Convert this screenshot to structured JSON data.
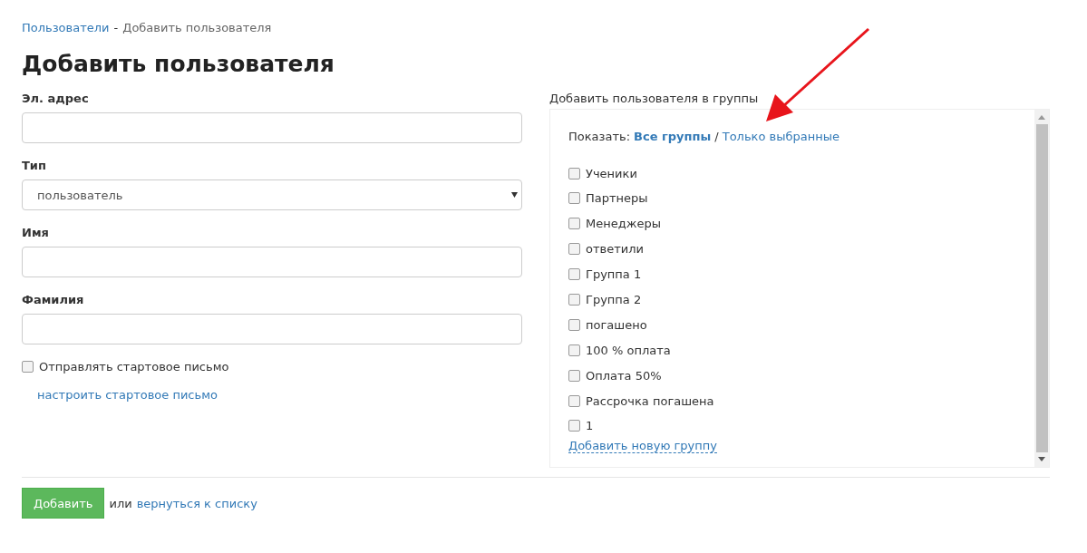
{
  "breadcrumb": {
    "parent": "Пользователи",
    "separator": "-",
    "current": "Добавить пользователя"
  },
  "title": "Добавить пользователя",
  "fields": [
    {
      "kind": "text",
      "label": "Эл. адрес"
    },
    {
      "kind": "select",
      "label": "Тип",
      "value": "пользователь"
    },
    {
      "kind": "text",
      "label": "Имя"
    },
    {
      "kind": "text",
      "label": "Фамилия"
    }
  ],
  "welcome_email": {
    "label": "Отправлять стартовое письмо",
    "checked": false,
    "link": "настроить стартовое письмо"
  },
  "groups": {
    "label": "Добавить пользователя в группы",
    "show_label": "Показать:",
    "separator": "/",
    "filters": [
      {
        "label": "Все группы",
        "selected": true
      },
      {
        "label": "Только выбранные",
        "selected": false
      }
    ],
    "items": [
      {
        "label": "Ученики",
        "checked": false
      },
      {
        "label": "Партнеры",
        "checked": false
      },
      {
        "label": "Менеджеры",
        "checked": false
      },
      {
        "label": "ответили",
        "checked": false
      },
      {
        "label": "Группа 1",
        "checked": false
      },
      {
        "label": "Группа 2",
        "checked": false
      },
      {
        "label": "погашено",
        "checked": false
      },
      {
        "label": "100 % оплата",
        "checked": false
      },
      {
        "label": "Оплата 50%",
        "checked": false
      },
      {
        "label": "Рассрочка погашена",
        "checked": false
      },
      {
        "label": "1",
        "checked": false
      }
    ],
    "add_link": "Добавить новую группу"
  },
  "footer": {
    "submit": "Добавить",
    "or": "или",
    "back_link": "вернуться к списку"
  }
}
